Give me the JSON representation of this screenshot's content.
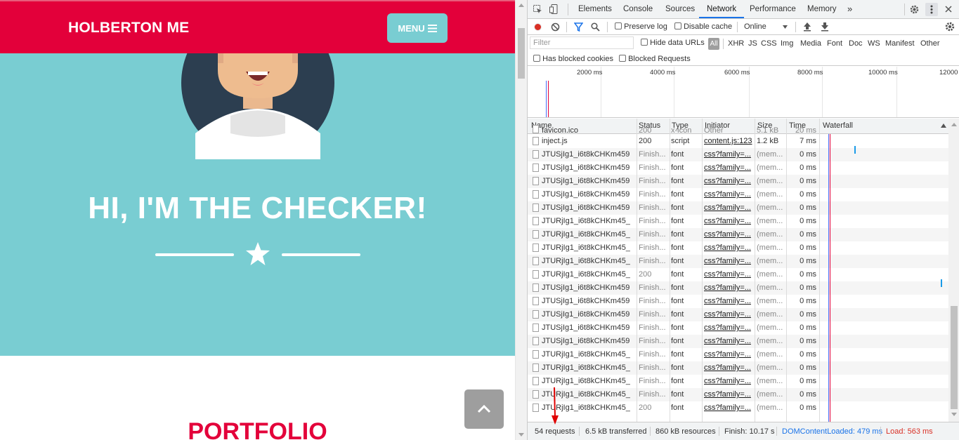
{
  "site": {
    "brand": "HOLBERTON ME",
    "menu_label": "MENU",
    "hero_title": "HI, I'M THE CHECKER!",
    "section_title": "PORTFOLIO",
    "colors": {
      "navbar": "#e3003a",
      "hero": "#79cdd2",
      "button": "#79cdd2",
      "scroll_top": "#9e9e9e"
    }
  },
  "devtools": {
    "tabs": [
      "Elements",
      "Console",
      "Sources",
      "Network",
      "Performance",
      "Memory"
    ],
    "active_tab": "Network",
    "more_tabs": "»",
    "toolbar": {
      "preserve_log": "Preserve log",
      "disable_cache": "Disable cache",
      "throttle": "Online"
    },
    "filter": {
      "placeholder": "Filter",
      "hide_data_urls": "Hide data URLs",
      "all": "All",
      "types": [
        "XHR",
        "JS",
        "CSS",
        "Img",
        "Media",
        "Font",
        "Doc",
        "WS",
        "Manifest",
        "Other"
      ],
      "has_blocked_cookies": "Has blocked cookies",
      "blocked_requests": "Blocked Requests"
    },
    "overview_ticks": [
      "2000 ms",
      "4000 ms",
      "6000 ms",
      "8000 ms",
      "10000 ms",
      "12000"
    ],
    "columns": {
      "name": "Name",
      "status": "Status",
      "type": "Type",
      "initiator": "Initiator",
      "size": "Size",
      "time": "Time",
      "waterfall": "Waterfall"
    },
    "partial_row": {
      "name": "favicon.ico",
      "status": "200",
      "type": "x-icon",
      "initiator": "Other",
      "size": "5.1 kB",
      "time": "20 ms"
    },
    "rows": [
      {
        "name": "inject.js",
        "status": "200",
        "type": "script",
        "initiator": "content.js:123",
        "size": "1.2 kB",
        "time": "7 ms"
      },
      {
        "name": "JTUSjIg1_i6t8kCHKm459...",
        "status": "Finish...",
        "type": "font",
        "initiator": "css?family=...",
        "size": "(mem...",
        "time": "0 ms"
      },
      {
        "name": "JTUSjIg1_i6t8kCHKm459...",
        "status": "Finish...",
        "type": "font",
        "initiator": "css?family=...",
        "size": "(mem...",
        "time": "0 ms"
      },
      {
        "name": "JTUSjIg1_i6t8kCHKm459...",
        "status": "Finish...",
        "type": "font",
        "initiator": "css?family=...",
        "size": "(mem...",
        "time": "0 ms"
      },
      {
        "name": "JTUSjIg1_i6t8kCHKm459...",
        "status": "Finish...",
        "type": "font",
        "initiator": "css?family=...",
        "size": "(mem...",
        "time": "0 ms"
      },
      {
        "name": "JTUSjIg1_i6t8kCHKm459...",
        "status": "Finish...",
        "type": "font",
        "initiator": "css?family=...",
        "size": "(mem...",
        "time": "0 ms"
      },
      {
        "name": "JTURjIg1_i6t8kCHKm45_...",
        "status": "Finish...",
        "type": "font",
        "initiator": "css?family=...",
        "size": "(mem...",
        "time": "0 ms"
      },
      {
        "name": "JTURjIg1_i6t8kCHKm45_...",
        "status": "Finish...",
        "type": "font",
        "initiator": "css?family=...",
        "size": "(mem...",
        "time": "0 ms"
      },
      {
        "name": "JTURjIg1_i6t8kCHKm45_...",
        "status": "Finish...",
        "type": "font",
        "initiator": "css?family=...",
        "size": "(mem...",
        "time": "0 ms"
      },
      {
        "name": "JTURjIg1_i6t8kCHKm45_...",
        "status": "Finish...",
        "type": "font",
        "initiator": "css?family=...",
        "size": "(mem...",
        "time": "0 ms"
      },
      {
        "name": "JTURjIg1_i6t8kCHKm45_...",
        "status": "200",
        "type": "font",
        "initiator": "css?family=...",
        "size": "(mem...",
        "time": "0 ms"
      },
      {
        "name": "JTUSjIg1_i6t8kCHKm459...",
        "status": "Finish...",
        "type": "font",
        "initiator": "css?family=...",
        "size": "(mem...",
        "time": "0 ms"
      },
      {
        "name": "JTUSjIg1_i6t8kCHKm459...",
        "status": "Finish...",
        "type": "font",
        "initiator": "css?family=...",
        "size": "(mem...",
        "time": "0 ms"
      },
      {
        "name": "JTUSjIg1_i6t8kCHKm459...",
        "status": "Finish...",
        "type": "font",
        "initiator": "css?family=...",
        "size": "(mem...",
        "time": "0 ms"
      },
      {
        "name": "JTUSjIg1_i6t8kCHKm459...",
        "status": "Finish...",
        "type": "font",
        "initiator": "css?family=...",
        "size": "(mem...",
        "time": "0 ms"
      },
      {
        "name": "JTUSjIg1_i6t8kCHKm459...",
        "status": "Finish...",
        "type": "font",
        "initiator": "css?family=...",
        "size": "(mem...",
        "time": "0 ms"
      },
      {
        "name": "JTURjIg1_i6t8kCHKm45_...",
        "status": "Finish...",
        "type": "font",
        "initiator": "css?family=...",
        "size": "(mem...",
        "time": "0 ms"
      },
      {
        "name": "JTURjIg1_i6t8kCHKm45_...",
        "status": "Finish...",
        "type": "font",
        "initiator": "css?family=...",
        "size": "(mem...",
        "time": "0 ms"
      },
      {
        "name": "JTURjIg1_i6t8kCHKm45_...",
        "status": "Finish...",
        "type": "font",
        "initiator": "css?family=...",
        "size": "(mem...",
        "time": "0 ms"
      },
      {
        "name": "JTURjIg1_i6t8kCHKm45_...",
        "status": "Finish...",
        "type": "font",
        "initiator": "css?family=...",
        "size": "(mem...",
        "time": "0 ms"
      },
      {
        "name": "JTURjIg1_i6t8kCHKm45_...",
        "status": "200",
        "type": "font",
        "initiator": "css?family=...",
        "size": "(mem...",
        "time": "0 ms"
      }
    ],
    "status_bar": {
      "requests": "54 requests",
      "transferred": "6.5 kB transferred",
      "resources": "860 kB resources",
      "finish": "Finish: 10.17 s",
      "dom_content_loaded": "DOMContentLoaded: 479 ms",
      "load": "Load: 563 ms"
    }
  }
}
